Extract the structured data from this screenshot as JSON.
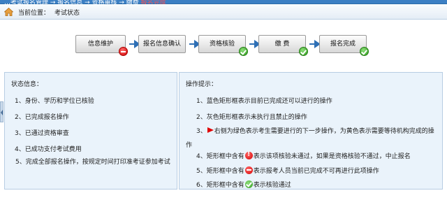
{
  "top_strip": {
    "fragment": "…考试报名管理 → 报名信息 → 资格审核 → 缴费",
    "fragment_red": "报名完成"
  },
  "location": {
    "label": "当前位置：",
    "value": "考试状态"
  },
  "steps": [
    {
      "label": "信息维护",
      "status": "blocked"
    },
    {
      "label": "报名信息确认",
      "status": "none"
    },
    {
      "label": "资格核验",
      "status": "passed"
    },
    {
      "label": "缴 费",
      "status": "passed"
    },
    {
      "label": "报名完成",
      "status": "passed"
    }
  ],
  "status_panel": {
    "title": "状态信息：",
    "items": [
      "1、身份、学历和学位已核验",
      "2、已完成报名操作",
      "3、已通过资格审查",
      "4、已成功支付考试费用",
      "5、完成全部报名操作，按规定时间打印准考证参加考试"
    ]
  },
  "tips_panel": {
    "title": "操作提示：",
    "tip1": "1、蓝色矩形框表示目前已完成还可以进行的操作",
    "tip2": "2、灰色矩形框表示未执行且禁止的操作",
    "tip3_prefix": "3、",
    "tip3_text": "右侧为绿色表示考生需要进行的下一步操作，为黄色表示需要等待机构完成的操作",
    "tip4_prefix": "4、矩形框中含有",
    "tip4_suffix": "表示该项核验未通过，如果是资格核验不通过，中止报名",
    "tip5_prefix": "5、矩形框中含有",
    "tip5_suffix": "表示报考人员当前已完成不可再进行此项操作",
    "tip6_prefix": "6、矩形框中含有",
    "tip6_suffix": "表示核验通过"
  },
  "colors": {
    "accent_blue": "#2e6fb5",
    "panel_bg": "#eaf3fb",
    "error_red": "#d40000",
    "success_green": "#2f9a1c"
  }
}
